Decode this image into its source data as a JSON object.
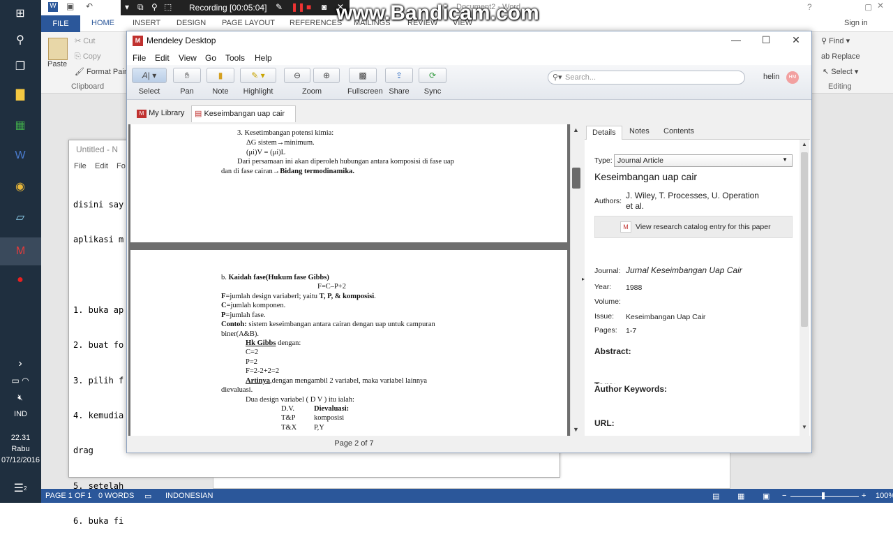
{
  "taskbar": {
    "time": "22.31",
    "day": "Rabu",
    "date": "07/12/2016",
    "lang": "IND",
    "notif_count": "2"
  },
  "word": {
    "title": "Document2 - Word",
    "signin": "Sign in",
    "tabs": [
      "FILE",
      "HOME",
      "INSERT",
      "DESIGN",
      "PAGE LAYOUT",
      "REFERENCES",
      "MAILINGS",
      "REVIEW",
      "VIEW"
    ],
    "clipboard": {
      "paste": "Paste",
      "cut": "Cut",
      "copy": "Copy",
      "format_painter": "Format Painter",
      "group": "Clipboard"
    },
    "editing": {
      "find": "Find",
      "replace": "Replace",
      "select": "Select",
      "group": "Editing"
    },
    "status": {
      "page": "PAGE 1 OF 1",
      "words": "0 WORDS",
      "lang": "INDONESIAN",
      "zoom": "100%"
    }
  },
  "notepad": {
    "title": "Untitled - N",
    "menu": [
      "File",
      "Edit",
      "Fo"
    ],
    "lines": [
      "disini say",
      "aplikasi m",
      "",
      "1. buka ap",
      "2. buat fo",
      "3. pilih f",
      "4. kemudia",
      "drag",
      "5. setelah",
      "6. buka fi"
    ]
  },
  "bandicam": {
    "recording": "Recording [00:05:04]",
    "watermark": "www.Bandicam.com"
  },
  "mendeley": {
    "title": "Mendeley Desktop",
    "menu": [
      "File",
      "Edit",
      "View",
      "Go",
      "Tools",
      "Help"
    ],
    "tools": [
      "Select",
      "Pan",
      "Note",
      "Highlight",
      "Zoom",
      "Fullscreen",
      "Share",
      "Sync"
    ],
    "search_placeholder": "Search...",
    "user": "helin",
    "avatar": "HM",
    "tabs": {
      "library": "My Library",
      "doc": "Keseimbangan uap cair"
    },
    "pager": "Page 2 of 7",
    "pdf_page1": [
      "3. Kesetimbangan potensi kimia:",
      "ΔG sistem→minimum.",
      "(μi)V = (μi)L",
      "Dari persamaan ini akan diperoleh hubungan antara komposisi di fase uap",
      "dan di fase cairan→",
      "Bidang termodinamika."
    ],
    "pdf_page2": {
      "heading_prefix": "b. ",
      "heading": "Kaidah fase(Hukum fase Gibbs)",
      "formula": "F=C–P+2",
      "f_line_rest": "=jumlah design variaberl; yaitu ",
      "f_line_bold": "T,  P,  &   komposisi",
      "c_line": "=jumlah komponen.",
      "p_line": "=jumlah fase.",
      "contoh_label": "Contoh:",
      "contoh_text": " sistem  keseimbangan  antara  cairan  dengan  uap  untuk  campuran",
      "biner": "biner(A&B).",
      "hk_label": "Hk Gibbs",
      "hk_rest": " dengan:",
      "c2": "C=2",
      "p2": "P=2",
      "f2": "F=2-2+2=2",
      "artinya_label": "Artinya",
      "artinya_text": ",dengan  mengambil  2  variabel,  maka  variabel  lainnya",
      "dievaluasi": "dievaluasi.",
      "dua": "Dua design variabel ( D V ) itu ialah:",
      "table": [
        [
          "D.V.",
          "Dievaluasi:"
        ],
        [
          "T&P",
          "komposisi"
        ],
        [
          "T&X",
          "P,Y"
        ]
      ]
    },
    "details": {
      "tabs": [
        "Details",
        "Notes",
        "Contents"
      ],
      "type_label": "Type:",
      "type_value": "Journal Article",
      "title": "Keseimbangan uap cair",
      "authors_label": "Authors:",
      "authors_line1": "J. Wiley, T. Processes, U. Operation",
      "authors_line2": "et al.",
      "catalog": "View research catalog entry for this paper",
      "journal_label": "Journal:",
      "journal": "Jurnal Keseimbangan Uap Cair",
      "year_label": "Year:",
      "year": "1988",
      "volume_label": "Volume:",
      "issue_label": "Issue:",
      "issue": "Keseimbangan Uap Cair",
      "pages_label": "Pages:",
      "pages": "1-7",
      "abstract": "Abstract:",
      "tags": "Tags:",
      "keywords": "Author Keywords:",
      "url": "URL:"
    }
  }
}
